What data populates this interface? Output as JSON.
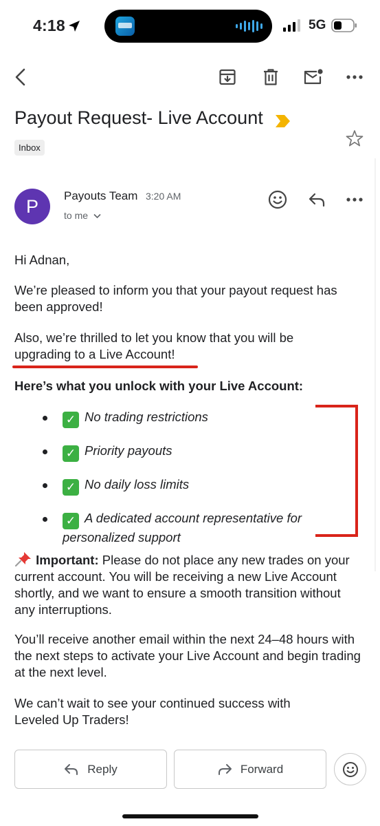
{
  "status_bar": {
    "time": "4:18",
    "network": "5G"
  },
  "toolbar": {
    "back_icon": "back-arrow-icon",
    "archive_icon": "archive-icon",
    "delete_icon": "trash-icon",
    "mark_unread_icon": "mail-unread-icon",
    "more_icon": "more-horizontal-icon"
  },
  "email": {
    "subject": "Payout Request- Live Account",
    "label": "Inbox",
    "sender": {
      "initial": "P",
      "name": "Payouts Team",
      "time": "3:20 AM",
      "recipient": "to me"
    },
    "body": {
      "greeting": "Hi Adnan,",
      "p1": "We’re pleased to inform you that your payout request has been approved!",
      "p2": "Also, we’re thrilled to let you know that you will be upgrading to a Live Account!",
      "unlock_heading": "Here’s what you unlock with your Live Account:",
      "bullets": [
        "No trading restrictions",
        "Priority payouts",
        "No daily loss limits",
        "A dedicated account representative for personalized support"
      ],
      "important_label": "Important:",
      "important_text": "Please do not place any new trades on your current account. You will be receiving a new Live Account shortly, and we want to ensure a smooth transition without any interruptions.",
      "p3": "You’ll receive another email within the next 24–48 hours with the next steps to activate your Live Account and begin trading at the next level.",
      "p4": "We can’t wait to see your continued success with Leveled Up Traders!"
    }
  },
  "actions": {
    "reply": "Reply",
    "forward": "Forward"
  },
  "colors": {
    "avatar": "#5e35b1",
    "annotation": "#d9241a",
    "important_marker": "#f4b400",
    "check": "#3cb043"
  }
}
